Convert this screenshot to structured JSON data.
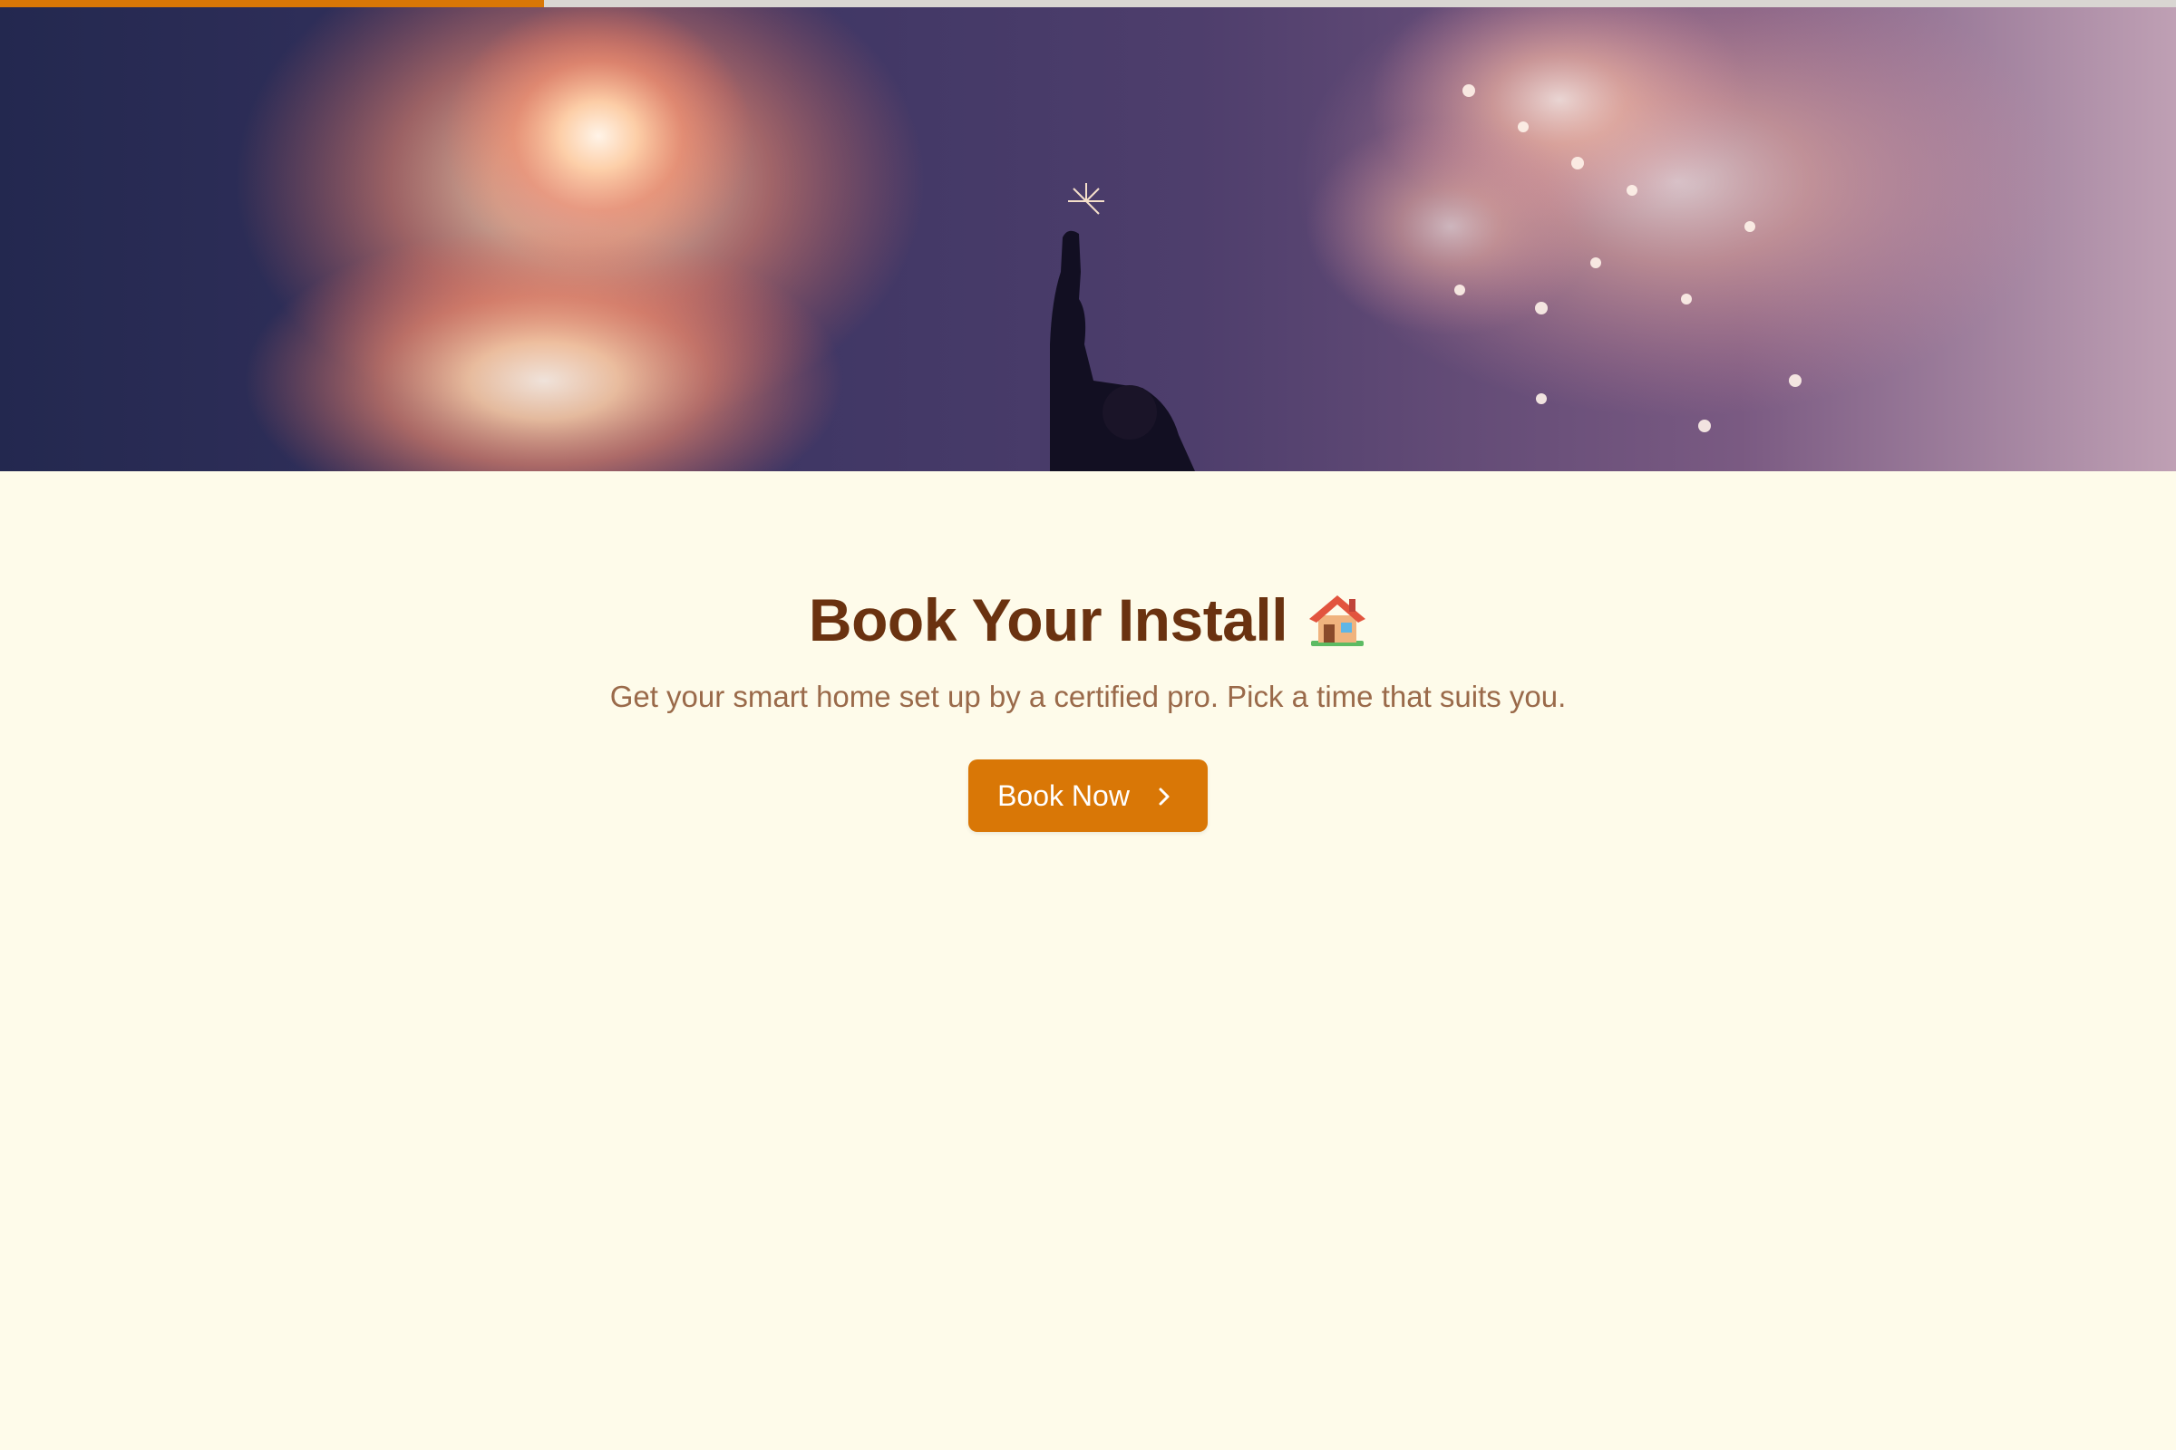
{
  "progress": {
    "value": 0.25,
    "fill_color": "#d97706",
    "track_color": "#d9d6d2"
  },
  "hero": {
    "image": "fireworks-celebration"
  },
  "main": {
    "title": "Book Your Install",
    "title_icon": "house-icon",
    "subtitle": "Get your smart home set up by a certified pro. Pick a time that suits you.",
    "cta_label": "Book Now",
    "cta_icon": "chevron-right-icon"
  },
  "colors": {
    "background": "#fefbea",
    "title": "#6a3210",
    "subtitle": "#9a6a4a",
    "accent": "#d97706"
  }
}
